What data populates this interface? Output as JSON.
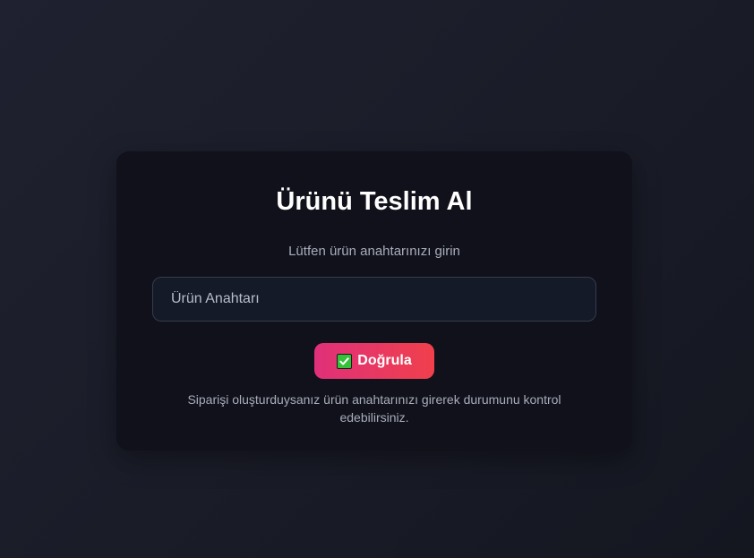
{
  "card": {
    "title": "Ürünü Teslim Al",
    "subtitle": "Lütfen ürün anahtarınızı girin",
    "input": {
      "placeholder": "Ürün Anahtarı",
      "value": ""
    },
    "button": {
      "icon": "check-mark-icon",
      "label": "Doğrula"
    },
    "note": "Siparişi oluşturduysanız ürün anahtarınızı girerek durumunu kontrol edebilirsiniz."
  },
  "colors": {
    "background": "#1a1c28",
    "card": "#10111a",
    "button_gradient_start": "#e0307a",
    "button_gradient_end": "#f0404c",
    "check_icon": "#34c23a"
  }
}
